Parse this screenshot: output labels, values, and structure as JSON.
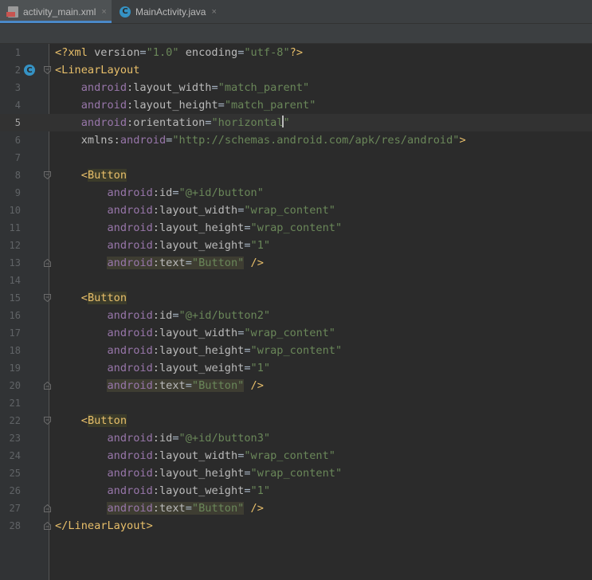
{
  "tabs": [
    {
      "label": "activity_main.xml",
      "active": true,
      "icon": "xml-file-icon"
    },
    {
      "label": "MainActivity.java",
      "active": false,
      "icon": "java-class-icon"
    }
  ],
  "close_glyph": "×",
  "java_icon_letter": "C",
  "current_line": 5,
  "lines": [
    {
      "n": "1",
      "tokens": [
        [
          "pi",
          "<?xml "
        ],
        [
          "attr",
          "version"
        ],
        [
          "",
          "="
        ],
        [
          "val",
          "\"1.0\""
        ],
        [
          "attr",
          " encoding"
        ],
        [
          "",
          "="
        ],
        [
          "val",
          "\"utf-8\""
        ],
        [
          "pi",
          "?>"
        ]
      ]
    },
    {
      "n": "2",
      "marker": true,
      "fold": "open",
      "tokens": [
        [
          "tag",
          "<LinearLayout"
        ]
      ]
    },
    {
      "n": "3",
      "tokens": [
        [
          "",
          "    "
        ],
        [
          "ns",
          "android"
        ],
        [
          "attr",
          ":layout_width"
        ],
        [
          "",
          "="
        ],
        [
          "val",
          "\"match_parent\""
        ]
      ]
    },
    {
      "n": "4",
      "tokens": [
        [
          "",
          "    "
        ],
        [
          "ns",
          "android"
        ],
        [
          "attr",
          ":layout_height"
        ],
        [
          "",
          "="
        ],
        [
          "val",
          "\"match_parent\""
        ]
      ]
    },
    {
      "n": "5",
      "tokens": [
        [
          "",
          "    "
        ],
        [
          "ns",
          "android"
        ],
        [
          "attr",
          ":orientation"
        ],
        [
          "",
          "="
        ],
        [
          "val",
          "\"horizontal"
        ],
        [
          "caret",
          ""
        ],
        [
          "val",
          "\""
        ]
      ]
    },
    {
      "n": "6",
      "tokens": [
        [
          "",
          "    "
        ],
        [
          "attr",
          "xmlns:"
        ],
        [
          "ns",
          "android"
        ],
        [
          "",
          "="
        ],
        [
          "val",
          "\"http://schemas.android.com/apk/res/android\""
        ],
        [
          "tag",
          ">"
        ]
      ]
    },
    {
      "n": "7",
      "tokens": []
    },
    {
      "n": "8",
      "fold": "open",
      "tokens": [
        [
          "",
          "    "
        ],
        [
          "tag",
          "<"
        ],
        [
          "taghl",
          "Button"
        ]
      ]
    },
    {
      "n": "9",
      "tokens": [
        [
          "",
          "        "
        ],
        [
          "ns",
          "android"
        ],
        [
          "attr",
          ":id"
        ],
        [
          "",
          "="
        ],
        [
          "val",
          "\"@+id/button\""
        ]
      ]
    },
    {
      "n": "10",
      "tokens": [
        [
          "",
          "        "
        ],
        [
          "ns",
          "android"
        ],
        [
          "attr",
          ":layout_width"
        ],
        [
          "",
          "="
        ],
        [
          "val",
          "\"wrap_content\""
        ]
      ]
    },
    {
      "n": "11",
      "tokens": [
        [
          "",
          "        "
        ],
        [
          "ns",
          "android"
        ],
        [
          "attr",
          ":layout_height"
        ],
        [
          "",
          "="
        ],
        [
          "val",
          "\"wrap_content\""
        ]
      ]
    },
    {
      "n": "12",
      "tokens": [
        [
          "",
          "        "
        ],
        [
          "ns",
          "android"
        ],
        [
          "attr",
          ":layout_weight"
        ],
        [
          "",
          "="
        ],
        [
          "val",
          "\"1\""
        ]
      ]
    },
    {
      "n": "13",
      "fold": "close",
      "tokens": [
        [
          "",
          "        "
        ],
        [
          "hlns",
          "android"
        ],
        [
          "hlattr",
          ":text"
        ],
        [
          "hl",
          "="
        ],
        [
          "hlval",
          "\"Button\""
        ],
        [
          "tag",
          " />"
        ]
      ]
    },
    {
      "n": "14",
      "tokens": []
    },
    {
      "n": "15",
      "fold": "open",
      "tokens": [
        [
          "",
          "    "
        ],
        [
          "tag",
          "<"
        ],
        [
          "taghl",
          "Button"
        ]
      ]
    },
    {
      "n": "16",
      "tokens": [
        [
          "",
          "        "
        ],
        [
          "ns",
          "android"
        ],
        [
          "attr",
          ":id"
        ],
        [
          "",
          "="
        ],
        [
          "val",
          "\"@+id/button2\""
        ]
      ]
    },
    {
      "n": "17",
      "tokens": [
        [
          "",
          "        "
        ],
        [
          "ns",
          "android"
        ],
        [
          "attr",
          ":layout_width"
        ],
        [
          "",
          "="
        ],
        [
          "val",
          "\"wrap_content\""
        ]
      ]
    },
    {
      "n": "18",
      "tokens": [
        [
          "",
          "        "
        ],
        [
          "ns",
          "android"
        ],
        [
          "attr",
          ":layout_height"
        ],
        [
          "",
          "="
        ],
        [
          "val",
          "\"wrap_content\""
        ]
      ]
    },
    {
      "n": "19",
      "tokens": [
        [
          "",
          "        "
        ],
        [
          "ns",
          "android"
        ],
        [
          "attr",
          ":layout_weight"
        ],
        [
          "",
          "="
        ],
        [
          "val",
          "\"1\""
        ]
      ]
    },
    {
      "n": "20",
      "fold": "close",
      "tokens": [
        [
          "",
          "        "
        ],
        [
          "hlns",
          "android"
        ],
        [
          "hlattr",
          ":text"
        ],
        [
          "hl",
          "="
        ],
        [
          "hlval",
          "\"Button\""
        ],
        [
          "tag",
          " />"
        ]
      ]
    },
    {
      "n": "21",
      "tokens": []
    },
    {
      "n": "22",
      "fold": "open",
      "tokens": [
        [
          "",
          "    "
        ],
        [
          "tag",
          "<"
        ],
        [
          "taghl",
          "Button"
        ]
      ]
    },
    {
      "n": "23",
      "tokens": [
        [
          "",
          "        "
        ],
        [
          "ns",
          "android"
        ],
        [
          "attr",
          ":id"
        ],
        [
          "",
          "="
        ],
        [
          "val",
          "\"@+id/button3\""
        ]
      ]
    },
    {
      "n": "24",
      "tokens": [
        [
          "",
          "        "
        ],
        [
          "ns",
          "android"
        ],
        [
          "attr",
          ":layout_width"
        ],
        [
          "",
          "="
        ],
        [
          "val",
          "\"wrap_content\""
        ]
      ]
    },
    {
      "n": "25",
      "tokens": [
        [
          "",
          "        "
        ],
        [
          "ns",
          "android"
        ],
        [
          "attr",
          ":layout_height"
        ],
        [
          "",
          "="
        ],
        [
          "val",
          "\"wrap_content\""
        ]
      ]
    },
    {
      "n": "26",
      "tokens": [
        [
          "",
          "        "
        ],
        [
          "ns",
          "android"
        ],
        [
          "attr",
          ":layout_weight"
        ],
        [
          "",
          "="
        ],
        [
          "val",
          "\"1\""
        ]
      ]
    },
    {
      "n": "27",
      "fold": "close",
      "tokens": [
        [
          "",
          "        "
        ],
        [
          "hlns",
          "android"
        ],
        [
          "hlattr",
          ":text"
        ],
        [
          "hl",
          "="
        ],
        [
          "hlval",
          "\"Button\""
        ],
        [
          "tag",
          " />"
        ]
      ]
    },
    {
      "n": "28",
      "fold": "close",
      "tokens": [
        [
          "tag",
          "</LinearLayout>"
        ]
      ]
    }
  ],
  "colors": {
    "background": "#2b2b2b",
    "gutter": "#313335",
    "tag": "#e8bf6a",
    "namespace": "#9876aa",
    "value": "#6a8759",
    "attribute": "#bababa",
    "accent": "#4a88c7"
  }
}
